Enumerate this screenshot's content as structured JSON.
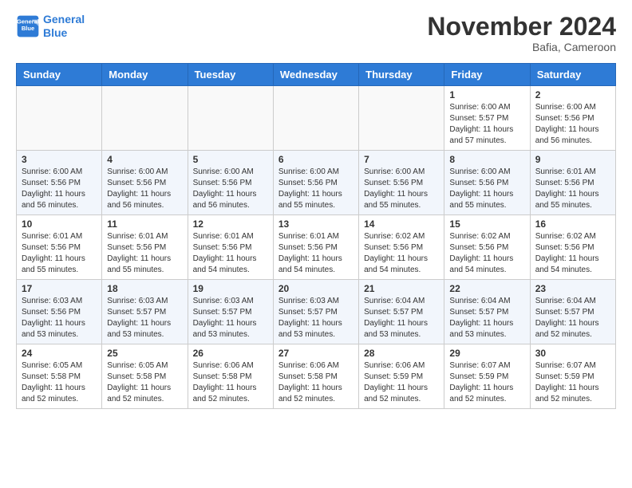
{
  "header": {
    "logo_line1": "General",
    "logo_line2": "Blue",
    "month_title": "November 2024",
    "location": "Bafia, Cameroon"
  },
  "weekdays": [
    "Sunday",
    "Monday",
    "Tuesday",
    "Wednesday",
    "Thursday",
    "Friday",
    "Saturday"
  ],
  "weeks": [
    [
      {
        "day": "",
        "info": ""
      },
      {
        "day": "",
        "info": ""
      },
      {
        "day": "",
        "info": ""
      },
      {
        "day": "",
        "info": ""
      },
      {
        "day": "",
        "info": ""
      },
      {
        "day": "1",
        "info": "Sunrise: 6:00 AM\nSunset: 5:57 PM\nDaylight: 11 hours\nand 57 minutes."
      },
      {
        "day": "2",
        "info": "Sunrise: 6:00 AM\nSunset: 5:56 PM\nDaylight: 11 hours\nand 56 minutes."
      }
    ],
    [
      {
        "day": "3",
        "info": "Sunrise: 6:00 AM\nSunset: 5:56 PM\nDaylight: 11 hours\nand 56 minutes."
      },
      {
        "day": "4",
        "info": "Sunrise: 6:00 AM\nSunset: 5:56 PM\nDaylight: 11 hours\nand 56 minutes."
      },
      {
        "day": "5",
        "info": "Sunrise: 6:00 AM\nSunset: 5:56 PM\nDaylight: 11 hours\nand 56 minutes."
      },
      {
        "day": "6",
        "info": "Sunrise: 6:00 AM\nSunset: 5:56 PM\nDaylight: 11 hours\nand 55 minutes."
      },
      {
        "day": "7",
        "info": "Sunrise: 6:00 AM\nSunset: 5:56 PM\nDaylight: 11 hours\nand 55 minutes."
      },
      {
        "day": "8",
        "info": "Sunrise: 6:00 AM\nSunset: 5:56 PM\nDaylight: 11 hours\nand 55 minutes."
      },
      {
        "day": "9",
        "info": "Sunrise: 6:01 AM\nSunset: 5:56 PM\nDaylight: 11 hours\nand 55 minutes."
      }
    ],
    [
      {
        "day": "10",
        "info": "Sunrise: 6:01 AM\nSunset: 5:56 PM\nDaylight: 11 hours\nand 55 minutes."
      },
      {
        "day": "11",
        "info": "Sunrise: 6:01 AM\nSunset: 5:56 PM\nDaylight: 11 hours\nand 55 minutes."
      },
      {
        "day": "12",
        "info": "Sunrise: 6:01 AM\nSunset: 5:56 PM\nDaylight: 11 hours\nand 54 minutes."
      },
      {
        "day": "13",
        "info": "Sunrise: 6:01 AM\nSunset: 5:56 PM\nDaylight: 11 hours\nand 54 minutes."
      },
      {
        "day": "14",
        "info": "Sunrise: 6:02 AM\nSunset: 5:56 PM\nDaylight: 11 hours\nand 54 minutes."
      },
      {
        "day": "15",
        "info": "Sunrise: 6:02 AM\nSunset: 5:56 PM\nDaylight: 11 hours\nand 54 minutes."
      },
      {
        "day": "16",
        "info": "Sunrise: 6:02 AM\nSunset: 5:56 PM\nDaylight: 11 hours\nand 54 minutes."
      }
    ],
    [
      {
        "day": "17",
        "info": "Sunrise: 6:03 AM\nSunset: 5:56 PM\nDaylight: 11 hours\nand 53 minutes."
      },
      {
        "day": "18",
        "info": "Sunrise: 6:03 AM\nSunset: 5:57 PM\nDaylight: 11 hours\nand 53 minutes."
      },
      {
        "day": "19",
        "info": "Sunrise: 6:03 AM\nSunset: 5:57 PM\nDaylight: 11 hours\nand 53 minutes."
      },
      {
        "day": "20",
        "info": "Sunrise: 6:03 AM\nSunset: 5:57 PM\nDaylight: 11 hours\nand 53 minutes."
      },
      {
        "day": "21",
        "info": "Sunrise: 6:04 AM\nSunset: 5:57 PM\nDaylight: 11 hours\nand 53 minutes."
      },
      {
        "day": "22",
        "info": "Sunrise: 6:04 AM\nSunset: 5:57 PM\nDaylight: 11 hours\nand 53 minutes."
      },
      {
        "day": "23",
        "info": "Sunrise: 6:04 AM\nSunset: 5:57 PM\nDaylight: 11 hours\nand 52 minutes."
      }
    ],
    [
      {
        "day": "24",
        "info": "Sunrise: 6:05 AM\nSunset: 5:58 PM\nDaylight: 11 hours\nand 52 minutes."
      },
      {
        "day": "25",
        "info": "Sunrise: 6:05 AM\nSunset: 5:58 PM\nDaylight: 11 hours\nand 52 minutes."
      },
      {
        "day": "26",
        "info": "Sunrise: 6:06 AM\nSunset: 5:58 PM\nDaylight: 11 hours\nand 52 minutes."
      },
      {
        "day": "27",
        "info": "Sunrise: 6:06 AM\nSunset: 5:58 PM\nDaylight: 11 hours\nand 52 minutes."
      },
      {
        "day": "28",
        "info": "Sunrise: 6:06 AM\nSunset: 5:59 PM\nDaylight: 11 hours\nand 52 minutes."
      },
      {
        "day": "29",
        "info": "Sunrise: 6:07 AM\nSunset: 5:59 PM\nDaylight: 11 hours\nand 52 minutes."
      },
      {
        "day": "30",
        "info": "Sunrise: 6:07 AM\nSunset: 5:59 PM\nDaylight: 11 hours\nand 52 minutes."
      }
    ]
  ]
}
